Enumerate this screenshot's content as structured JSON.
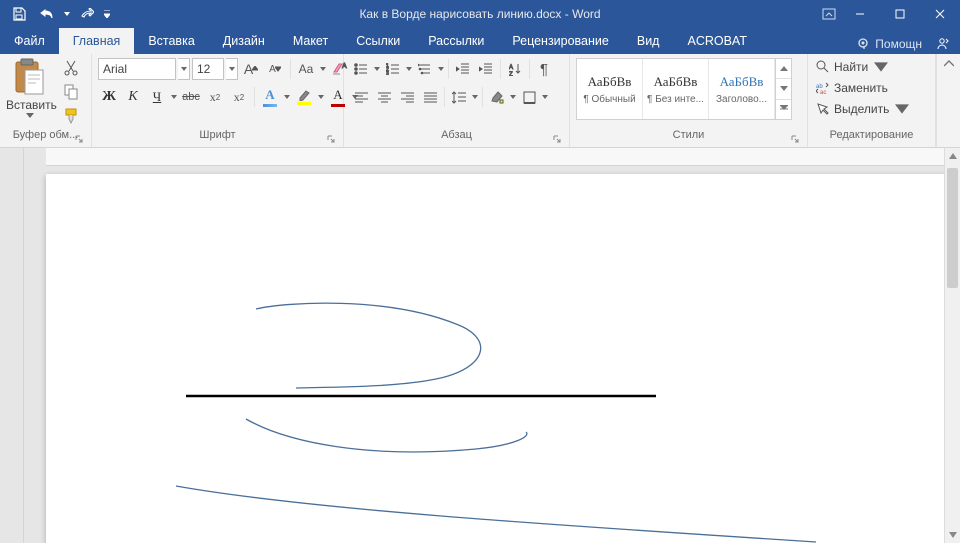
{
  "title": "Как в Ворде нарисовать линию.docx - Word",
  "qat": {
    "save": "Сохранить",
    "undo": "Отменить",
    "redo": "Повторить"
  },
  "tabs": {
    "file": "Файл",
    "home": "Главная",
    "insert": "Вставка",
    "design": "Дизайн",
    "layout": "Макет",
    "references": "Ссылки",
    "mailings": "Рассылки",
    "review": "Рецензирование",
    "view": "Вид",
    "acrobat": "ACROBAT",
    "tellme": "Помощн"
  },
  "clipboard": {
    "paste": "Вставить",
    "group": "Буфер обм..."
  },
  "font": {
    "name": "Arial",
    "size": "12",
    "group": "Шрифт",
    "bold": "Ж",
    "italic": "К",
    "underline": "Ч",
    "strike": "abc",
    "aa": "Aa",
    "grow": "A",
    "shrink": "A"
  },
  "paragraph": {
    "group": "Абзац"
  },
  "styles": {
    "group": "Стили",
    "sample": "АаБбВв",
    "items": [
      {
        "name": "¶ Обычный"
      },
      {
        "name": "¶ Без инте..."
      },
      {
        "name": "Заголово..."
      }
    ]
  },
  "editing": {
    "group": "Редактирование",
    "find": "Найти",
    "replace": "Заменить",
    "select": "Выделить"
  }
}
